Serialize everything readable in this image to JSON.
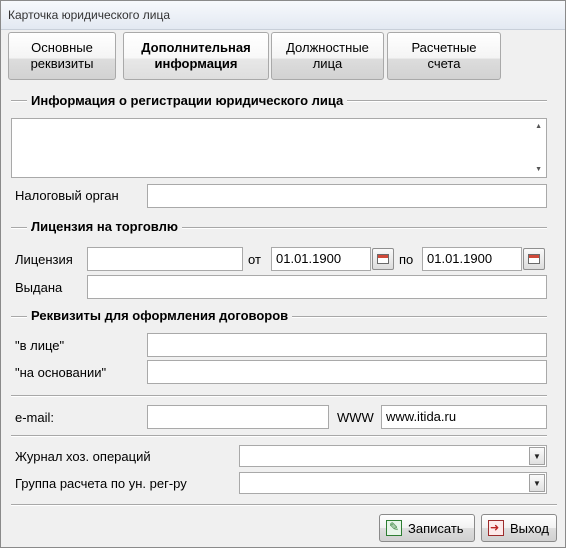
{
  "window": {
    "title": "Карточка юридического лица"
  },
  "tabs": [
    {
      "label": "Основные\nреквизиты"
    },
    {
      "label": "Дополнительная\nинформация"
    },
    {
      "label": "Должностные\nлица"
    },
    {
      "label": "Расчетные\nсчета"
    }
  ],
  "registration": {
    "section_title": "Информация о регистрации юридического лица",
    "memo_value": "",
    "tax_office_label": "Налоговый орган",
    "tax_office_value": ""
  },
  "license": {
    "section_title": "Лицензия на торговлю",
    "license_label": "Лицензия",
    "license_value": "",
    "from_label": "от",
    "from_date": "01.01.1900",
    "to_label": "по",
    "to_date": "01.01.1900",
    "issued_label": "Выдана",
    "issued_value": ""
  },
  "contract": {
    "section_title": "Реквизиты для оформления договоров",
    "in_person_label": "\"в лице\"",
    "in_person_value": "",
    "basis_label": "\"на основании\"",
    "basis_value": ""
  },
  "contacts": {
    "email_label": "e-mail:",
    "email_value": "",
    "www_label": "WWW",
    "www_value": "www.itida.ru"
  },
  "operations": {
    "journal_label": "Журнал хоз. операций",
    "journal_value": "",
    "group_label": "Группа расчета по ун. рег-ру",
    "group_value": ""
  },
  "buttons": {
    "save_label": "Записать",
    "exit_label": "Выход"
  },
  "icons": [
    "calendar-icon",
    "dropdown-arrow-icon",
    "save-icon",
    "exit-icon",
    "scroll-up-icon",
    "scroll-down-icon"
  ]
}
